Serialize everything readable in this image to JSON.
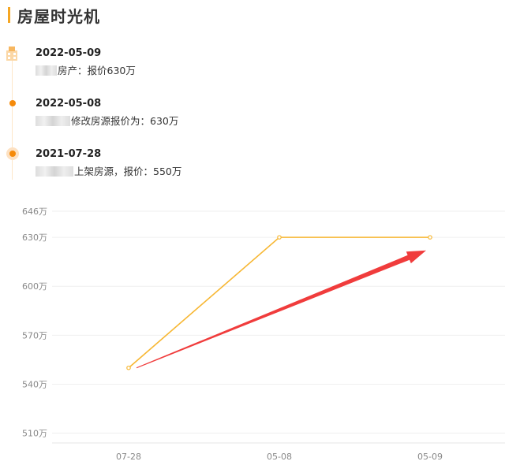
{
  "header": {
    "title": "房屋时光机"
  },
  "timeline": [
    {
      "date": "2022-05-09",
      "text": "房产：报价630万"
    },
    {
      "date": "2022-05-08",
      "text": "修改房源报价为：630万"
    },
    {
      "date": "2021-07-28",
      "text": "上架房源，报价：550万"
    }
  ],
  "colors": {
    "accent": "#f5a623",
    "line": "#f7b733",
    "arrow": "#f03c3c",
    "dot": "#f58a0a"
  },
  "chart_data": {
    "type": "line",
    "categories": [
      "07-28",
      "05-08",
      "05-09"
    ],
    "series": [
      {
        "values": [
          550,
          630,
          630
        ]
      }
    ],
    "yticks": [
      "510万",
      "540万",
      "570万",
      "600万",
      "630万",
      "646万"
    ],
    "yvalues": [
      510,
      540,
      570,
      600,
      630,
      646
    ],
    "ylim": [
      504,
      646
    ],
    "grid": true,
    "annotation": {
      "type": "arrow",
      "from": {
        "x": "07-28",
        "y": 550
      },
      "to": {
        "x": "05-09",
        "y": 622
      }
    }
  }
}
